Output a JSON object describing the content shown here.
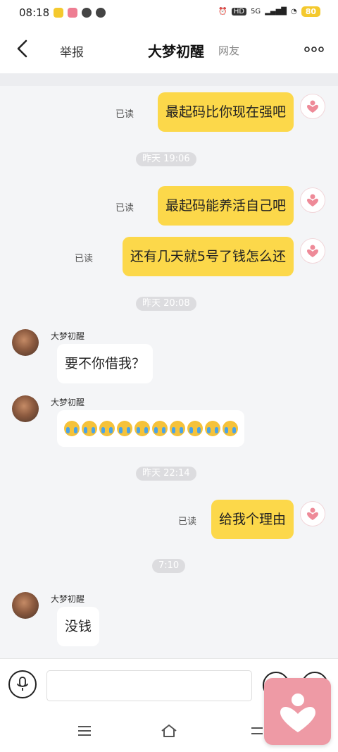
{
  "status_bar": {
    "time": "08:18",
    "network": "5G",
    "battery": "80"
  },
  "nav": {
    "report": "举报",
    "title": "大梦初醒",
    "relation": "网友"
  },
  "messages": [
    {
      "type": "out",
      "text": "最起码比你现在强吧",
      "status": "已读"
    },
    {
      "type": "time",
      "text": "昨天 19:06"
    },
    {
      "type": "out",
      "text": "最起码能养活自己吧",
      "status": "已读"
    },
    {
      "type": "out",
      "text": "还有几天就5号了钱怎么还",
      "status": "已读"
    },
    {
      "type": "time",
      "text": "昨天 20:08"
    },
    {
      "type": "in",
      "sender": "大梦初醒",
      "text": "要不你借我？"
    },
    {
      "type": "in",
      "sender": "大梦初醒",
      "emoji": "crying-face",
      "emoji_count": 10
    },
    {
      "type": "time",
      "text": "昨天 22:14"
    },
    {
      "type": "out",
      "text": "给我个理由",
      "status": "已读"
    },
    {
      "type": "time",
      "text": "7:10"
    },
    {
      "type": "in",
      "sender": "大梦初醒",
      "text": "没钱"
    }
  ],
  "input": {
    "placeholder": ""
  },
  "colors": {
    "bubble_out": "#fcd84a",
    "bubble_in": "#ffffff",
    "chat_bg": "#f4f5f7",
    "accent_pink": "#ee9aa5"
  }
}
